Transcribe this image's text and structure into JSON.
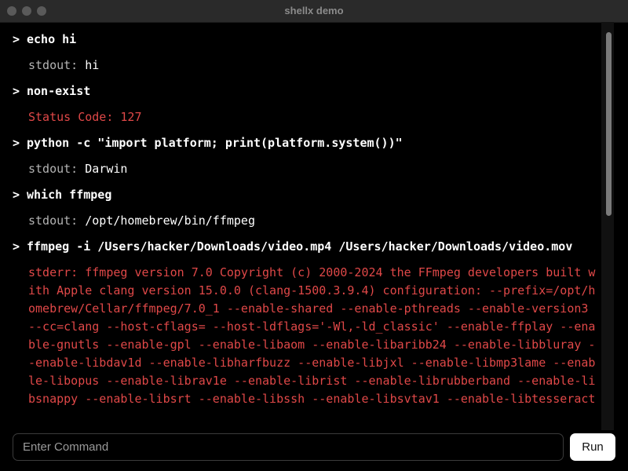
{
  "window": {
    "title": "shellx demo"
  },
  "log": [
    {
      "command": "echo hi",
      "output_label": "stdout: ",
      "output": "hi",
      "type": "stdout"
    },
    {
      "command": "non-exist",
      "output_label": "",
      "output": "Status Code: 127",
      "type": "error"
    },
    {
      "command": "python -c \"import platform; print(platform.system())\"",
      "output_label": "stdout: ",
      "output": "Darwin",
      "type": "stdout"
    },
    {
      "command": "which ffmpeg",
      "output_label": "stdout: ",
      "output": "/opt/homebrew/bin/ffmpeg",
      "type": "stdout"
    },
    {
      "command": "ffmpeg -i /Users/hacker/Downloads/video.mp4 /Users/hacker/Downloads/video.mov",
      "output_label": "",
      "output": "stderr: ffmpeg version 7.0 Copyright (c) 2000-2024 the FFmpeg developers built with Apple clang version 15.0.0 (clang-1500.3.9.4) configuration: --prefix=/opt/homebrew/Cellar/ffmpeg/7.0_1 --enable-shared --enable-pthreads --enable-version3 --cc=clang --host-cflags= --host-ldflags='-Wl,-ld_classic' --enable-ffplay --enable-gnutls --enable-gpl --enable-libaom --enable-libaribb24 --enable-libbluray --enable-libdav1d --enable-libharfbuzz --enable-libjxl --enable-libmp3lame --enable-libopus --enable-librav1e --enable-librist --enable-librubberband --enable-libsnappy --enable-libsrt --enable-libssh --enable-libsvtav1 --enable-libtesseract",
      "type": "error"
    }
  ],
  "prompt_symbol": ">",
  "input": {
    "placeholder": "Enter Command",
    "value": ""
  },
  "run_label": "Run",
  "colors": {
    "error": "#e04848",
    "background": "#000000",
    "label": "#b3b3b3"
  }
}
